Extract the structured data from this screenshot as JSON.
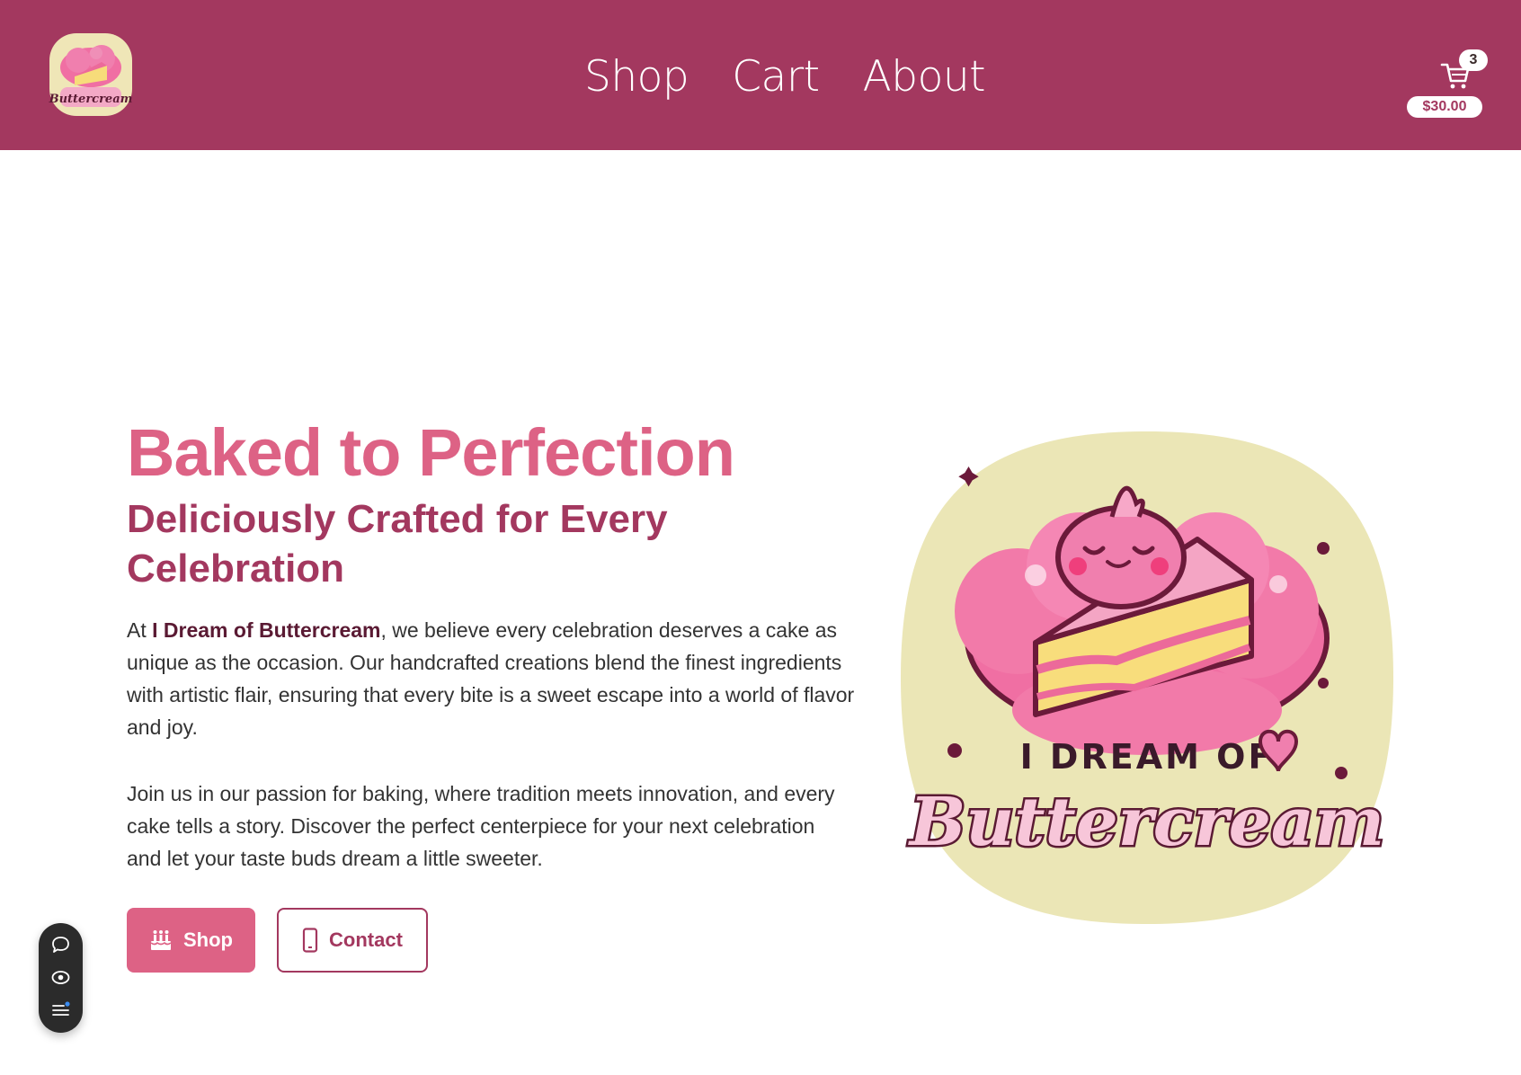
{
  "header": {
    "logo_alt": "I Dream of Buttercream",
    "nav": [
      {
        "label": "Shop"
      },
      {
        "label": "Cart"
      },
      {
        "label": "About"
      }
    ],
    "cart": {
      "count": "3",
      "total": "$30.00",
      "icon": "cart-icon"
    }
  },
  "hero": {
    "title": "Baked to Perfection",
    "subtitle": "Deliciously Crafted for Every Celebration",
    "paragraph1_prefix": "At ",
    "paragraph1_brand": "I Dream of Buttercream",
    "paragraph1_rest": ", we believe every celebration deserves a cake as unique as the occasion. Our handcrafted creations blend the finest ingredients with artistic flair, ensuring that every bite is a sweet escape into a world of flavor and joy.",
    "paragraph2": "Join us in our passion for baking, where tradition meets innovation, and every cake tells a story. Discover the perfect centerpiece for your next celebration and let your taste buds dream a little sweeter.",
    "buttons": [
      {
        "label": "Shop",
        "icon": "birthday-cake-icon"
      },
      {
        "label": "Contact",
        "icon": "mobile-phone-icon"
      }
    ],
    "image": {
      "line1": "I DREAM OF",
      "line2": "Buttercream"
    }
  },
  "floating_toolbar": {
    "items": [
      "chat-bubble-icon",
      "eye-icon",
      "menu-list-icon"
    ]
  },
  "colors": {
    "brand": "#a3385f",
    "accent": "#dd6285",
    "cream": "#ebe6b6"
  }
}
